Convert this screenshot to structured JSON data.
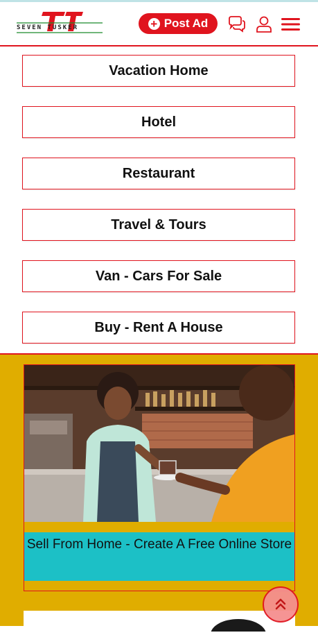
{
  "header": {
    "logo_text": "SEVEN TUSKER",
    "post_ad_label": "Post Ad",
    "icons": [
      "plus-icon",
      "chat-icon",
      "user-icon",
      "menu-icon"
    ]
  },
  "categories": [
    "Vacation Home",
    "Hotel",
    "Restaurant",
    "Travel & Tours",
    "Van - Cars For Sale",
    "Buy - Rent A House"
  ],
  "promo": {
    "caption": "Sell From Home - Create A Free Online Store"
  },
  "colors": {
    "brand_red": "#e0141e",
    "promo_bg": "#e0ad00",
    "caption_bg": "#1cc0c6"
  }
}
